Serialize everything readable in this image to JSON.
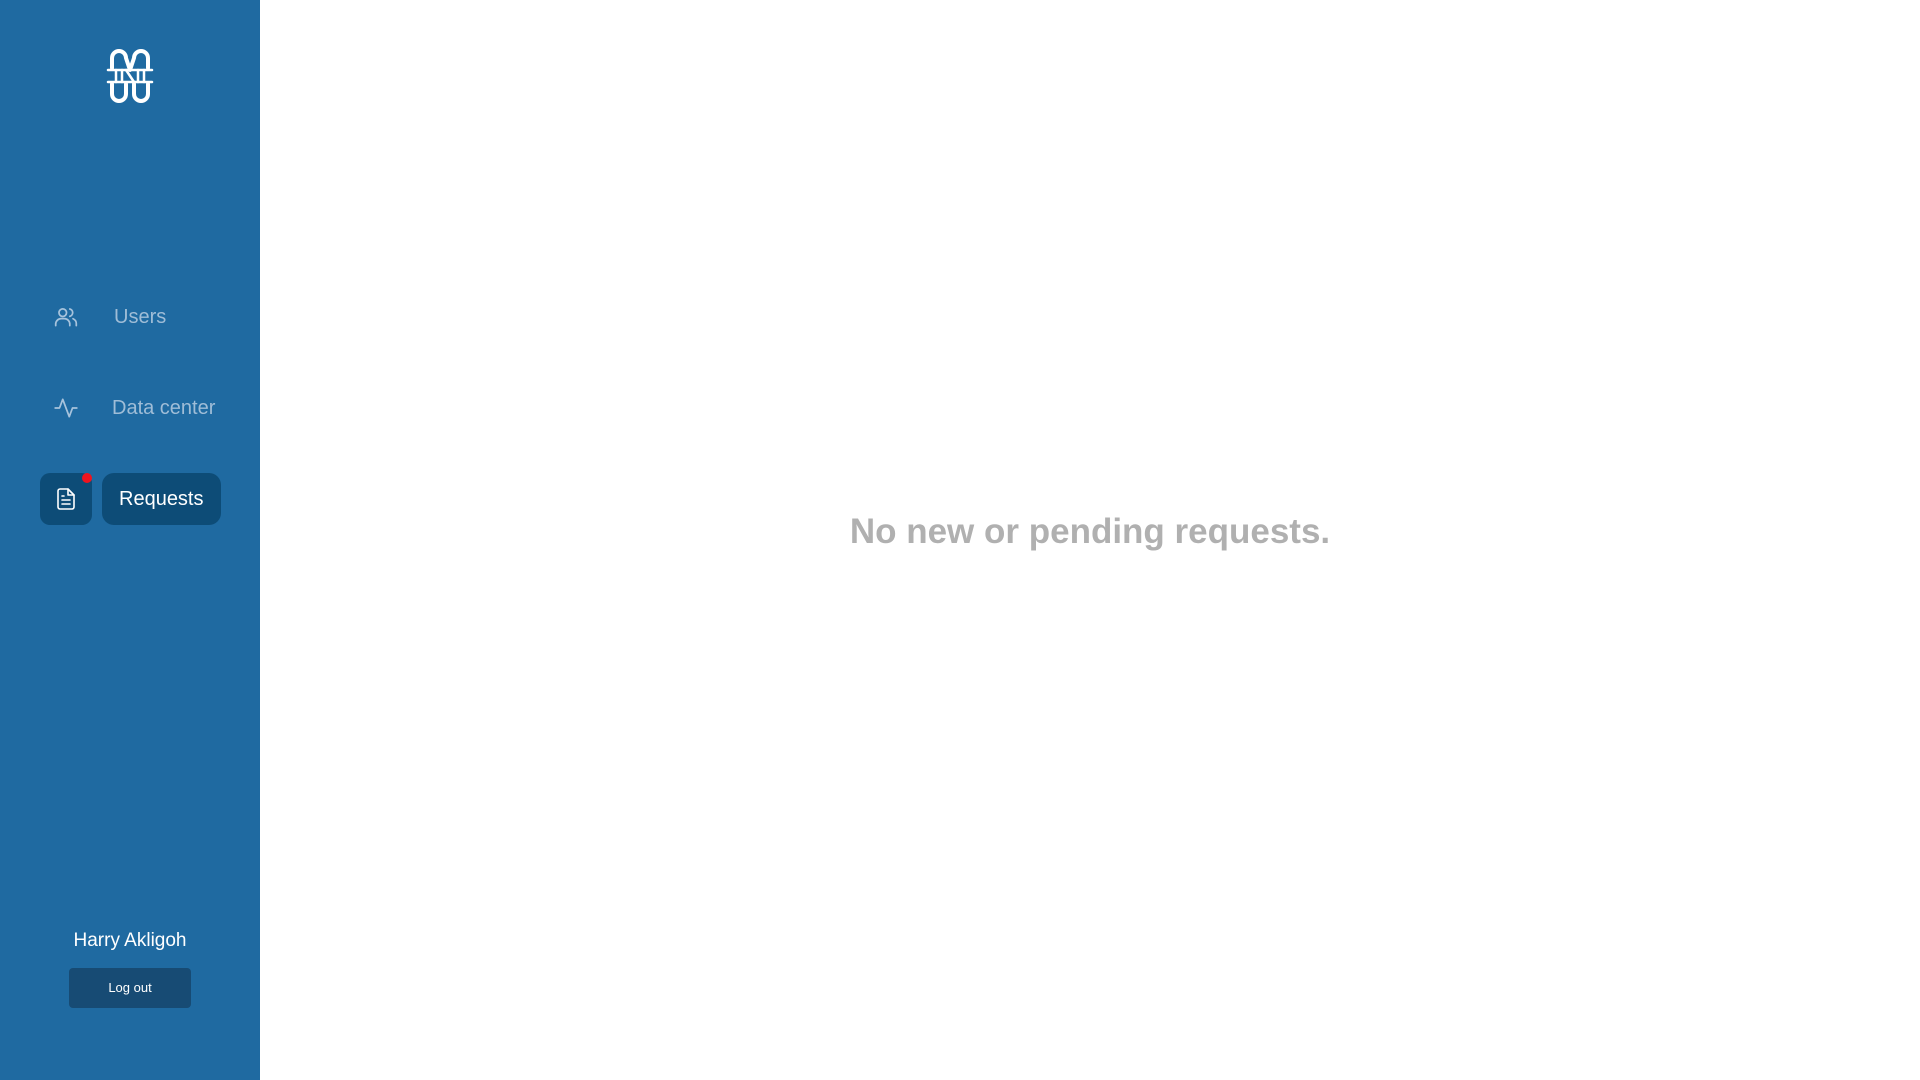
{
  "app": {
    "logo_icon": "stylized-m-logo-icon"
  },
  "sidebar": {
    "background": "#1f6aa1",
    "active_color": "#0d4c77",
    "items": [
      {
        "label": "Users",
        "icon": "users-icon",
        "active": false
      },
      {
        "label": "Data center",
        "icon": "activity-pulse-icon",
        "active": false
      },
      {
        "label": "Requests",
        "icon": "document-icon",
        "active": true,
        "has_notification": true
      }
    ],
    "notification_color": "#f0141e",
    "user": {
      "name": "Harry Akligoh",
      "logout_label": "Log out"
    }
  },
  "main": {
    "empty_message": "No new or pending requests."
  }
}
